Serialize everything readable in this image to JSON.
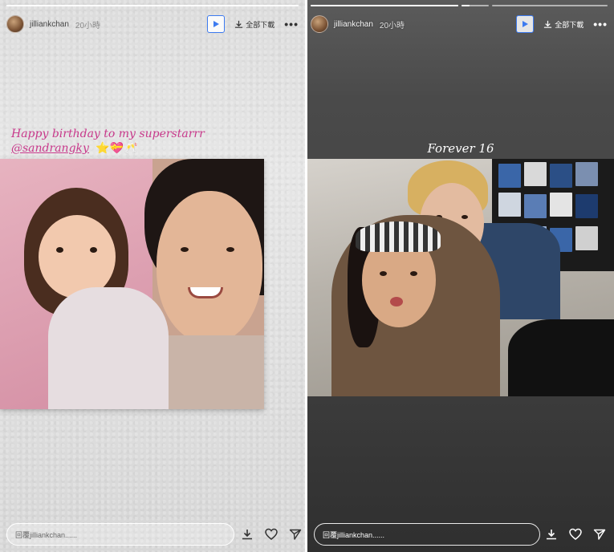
{
  "stories": [
    {
      "username": "jilliankchan",
      "time": "20小時",
      "download_label": "全部下載",
      "caption_line1": "Happy birthday to my superstarrr",
      "caption_mention": "@sandrangky",
      "caption_emoji": "⭐💝🥂",
      "reply_placeholder": "回覆jilliankchan......",
      "progress": [
        1.0
      ]
    },
    {
      "username": "jilliankchan",
      "time": "20小時",
      "download_label": "全部下載",
      "caption": "Forever 16",
      "reply_placeholder": "回覆jilliankchan......",
      "progress": [
        1.0,
        0.3,
        0.0
      ]
    }
  ],
  "icons": {
    "play": "play-icon",
    "download": "download-icon",
    "more": "more-icon",
    "save": "save-icon",
    "like": "heart-icon",
    "share": "send-icon"
  },
  "colors": {
    "accent": "#3d7bf0",
    "caption_pink": "#c8398b"
  }
}
